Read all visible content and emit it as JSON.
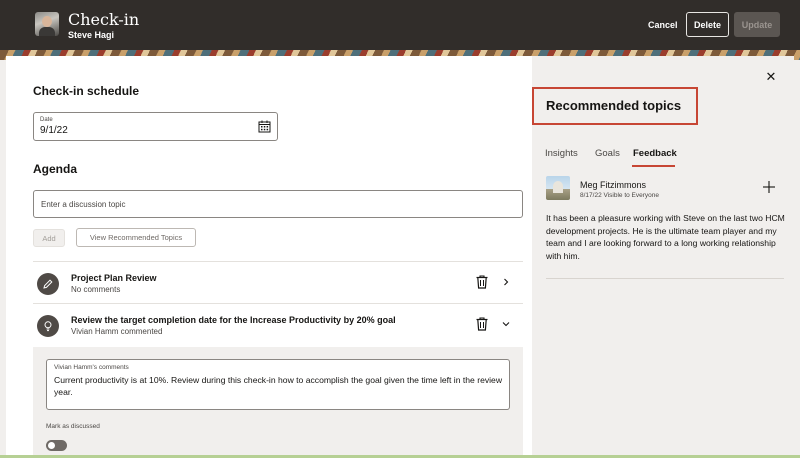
{
  "header": {
    "title": "Check-in",
    "subtitle": "Steve Hagi",
    "cancel_label": "Cancel",
    "delete_label": "Delete",
    "update_label": "Update"
  },
  "schedule": {
    "heading": "Check-in schedule",
    "date_label": "Date",
    "date_value": "9/1/22"
  },
  "agenda": {
    "heading": "Agenda",
    "input_placeholder": "Enter a discussion topic",
    "add_label": "Add",
    "view_recommended_label": "View Recommended Topics",
    "items": [
      {
        "title": "Project Plan Review",
        "subtitle": "No comments",
        "icon": "pencil-icon"
      },
      {
        "title": "Review the target completion date for the Increase Productivity by 20% goal",
        "subtitle": "Vivian Hamm commented",
        "icon": "lightbulb-icon"
      }
    ],
    "comment": {
      "label": "Vivian Hamm's comments",
      "text": "Current productivity is at 10%. Review during this check-in how to accomplish the goal given the time left in the review year.",
      "mark_label": "Mark as discussed"
    }
  },
  "recommended": {
    "title": "Recommended topics",
    "tabs": [
      {
        "label": "Insights",
        "active": false
      },
      {
        "label": "Goals",
        "active": false
      },
      {
        "label": "Feedback",
        "active": true
      }
    ],
    "feedback": {
      "author": "Meg Fitzimmons",
      "meta": "8/17/22 Visible to Everyone",
      "text": "It has been a pleasure working with Steve on the last two HCM development projects. He is the ultimate team player and my team and I are looking forward to a long working relationship with him."
    }
  },
  "colors": {
    "header_bg": "#312d2a",
    "accent": "#c74634",
    "panel_bg": "#f1efed"
  }
}
